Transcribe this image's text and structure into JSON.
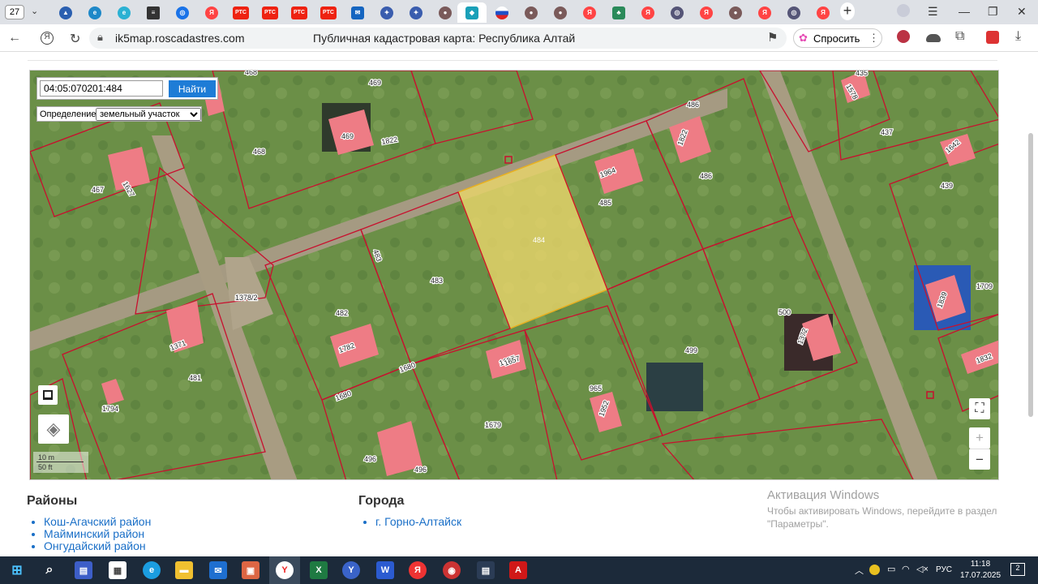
{
  "browser": {
    "tab_count": "27",
    "url": "ik5map.roscadastres.com",
    "page_title": "Публичная кадастровая карта: Республика Алтай",
    "ask_label": "Спросить",
    "tab_icons": [
      "gosuslugi",
      "edge",
      "edge",
      "menu",
      "globe",
      "yandex",
      "rts",
      "rts",
      "rts",
      "rts",
      "mail",
      "gerb",
      "gerb",
      "person",
      "active-site",
      "flag",
      "person",
      "person",
      "yandex",
      "tree",
      "yandex",
      "globe",
      "yandex",
      "person",
      "yandex",
      "globe",
      "yandex"
    ]
  },
  "search": {
    "value": "04:05:070201:484",
    "button": "Найти"
  },
  "definition": {
    "label": "Определение:",
    "selected": "земельный участок"
  },
  "map": {
    "scale_m": "10 m",
    "scale_ft": "50 ft",
    "zoom_in": "+",
    "zoom_out": "−",
    "highlight_color": "#e8d46a",
    "boundary_color": "#c8102e",
    "building_color": "#ee7c85",
    "labels": [
      "468",
      "469",
      "469",
      "468",
      "467",
      "486",
      "1964",
      "485",
      "486",
      "484",
      "483",
      "483",
      "482",
      "1782",
      "1378/2",
      "1371",
      "481",
      "1680",
      "1680",
      "1697",
      "965",
      "1679",
      "496",
      "496",
      "500",
      "499",
      "435",
      "437",
      "439",
      "1709",
      "1832",
      "1794",
      "1627",
      "1822",
      "1642",
      "1578",
      "1372",
      "1839",
      "1657",
      "1822",
      "1952"
    ]
  },
  "footer": {
    "districts_title": "Районы",
    "districts": [
      "Кош-Агачский район",
      "Майминский район",
      "Онгудайский район"
    ],
    "cities_title": "Города",
    "cities": [
      "г. Горно-Алтайск"
    ]
  },
  "watermark": {
    "title": "Активация Windows",
    "text": "Чтобы активировать Windows, перейдите в раздел \"Параметры\"."
  },
  "taskbar": {
    "lang": "РУС",
    "time": "11:18",
    "date": "17.07.2025",
    "notif": "2"
  }
}
